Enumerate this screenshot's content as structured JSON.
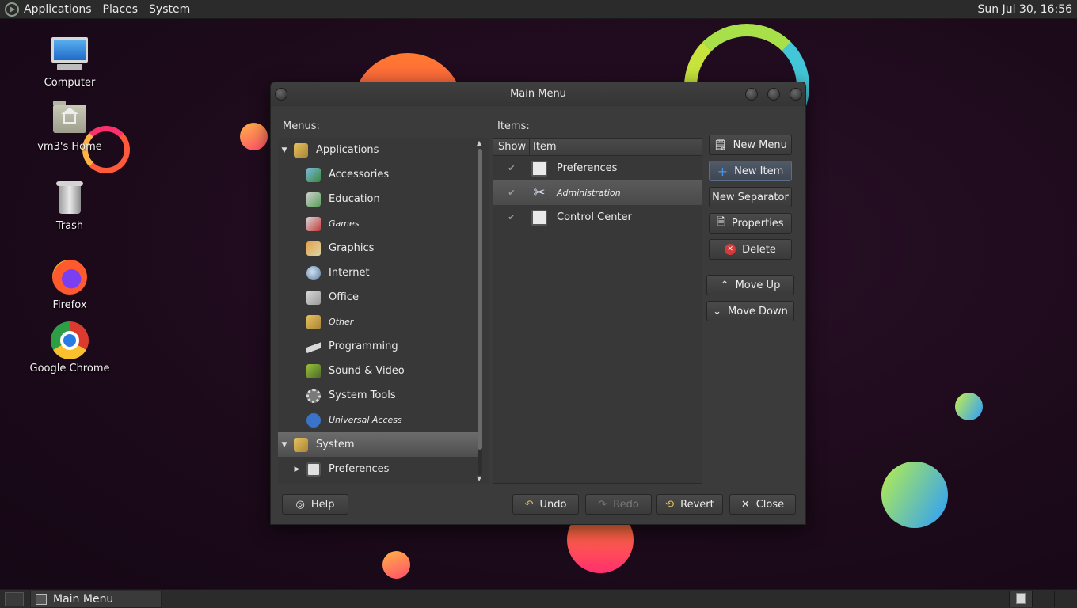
{
  "top_panel": {
    "menus": [
      "Applications",
      "Places",
      "System"
    ],
    "clock": "Sun Jul 30, 16:56"
  },
  "desktop_icons": [
    {
      "label": "Computer",
      "icon": "computer-icon"
    },
    {
      "label": "vm3's Home",
      "icon": "home-folder-icon"
    },
    {
      "label": "Trash",
      "icon": "trash-icon"
    },
    {
      "label": "Firefox",
      "icon": "firefox-icon"
    },
    {
      "label": "Google Chrome",
      "icon": "chrome-icon"
    }
  ],
  "window": {
    "title": "Main Menu",
    "menus_label": "Menus:",
    "items_label": "Items:",
    "tree": [
      {
        "label": "Applications",
        "level": 0,
        "expanded": true
      },
      {
        "label": "Accessories",
        "level": 1
      },
      {
        "label": "Education",
        "level": 1
      },
      {
        "label": "Games",
        "level": 1,
        "hidden": true
      },
      {
        "label": "Graphics",
        "level": 1
      },
      {
        "label": "Internet",
        "level": 1
      },
      {
        "label": "Office",
        "level": 1
      },
      {
        "label": "Other",
        "level": 1,
        "hidden": true
      },
      {
        "label": "Programming",
        "level": 1
      },
      {
        "label": "Sound & Video",
        "level": 1
      },
      {
        "label": "System Tools",
        "level": 1
      },
      {
        "label": "Universal Access",
        "level": 1,
        "hidden": true
      },
      {
        "label": "System",
        "level": 0,
        "expanded": true,
        "selected": true
      },
      {
        "label": "Preferences",
        "level": 1,
        "collapsed": true
      }
    ],
    "items_columns": {
      "show": "Show",
      "item": "Item"
    },
    "items": [
      {
        "label": "Preferences",
        "checked": true
      },
      {
        "label": "Administration",
        "checked": true,
        "selected": true,
        "hidden": true
      },
      {
        "label": "Control Center",
        "checked": true
      }
    ],
    "buttons": {
      "new_menu": "New Menu",
      "new_item": "New Item",
      "new_separator": "New Separator",
      "properties": "Properties",
      "delete": "Delete",
      "move_up": "Move Up",
      "move_down": "Move Down",
      "help": "Help",
      "undo": "Undo",
      "redo": "Redo",
      "revert": "Revert",
      "close": "Close"
    }
  },
  "taskbar": {
    "task_label": "Main Menu"
  },
  "colors": {
    "panel": "#2b2b2b",
    "window_bg": "#3b3b3b",
    "selection": "#5a5a5a",
    "accent_blue": "#4a90e2",
    "delete_red": "#d53a3a"
  }
}
